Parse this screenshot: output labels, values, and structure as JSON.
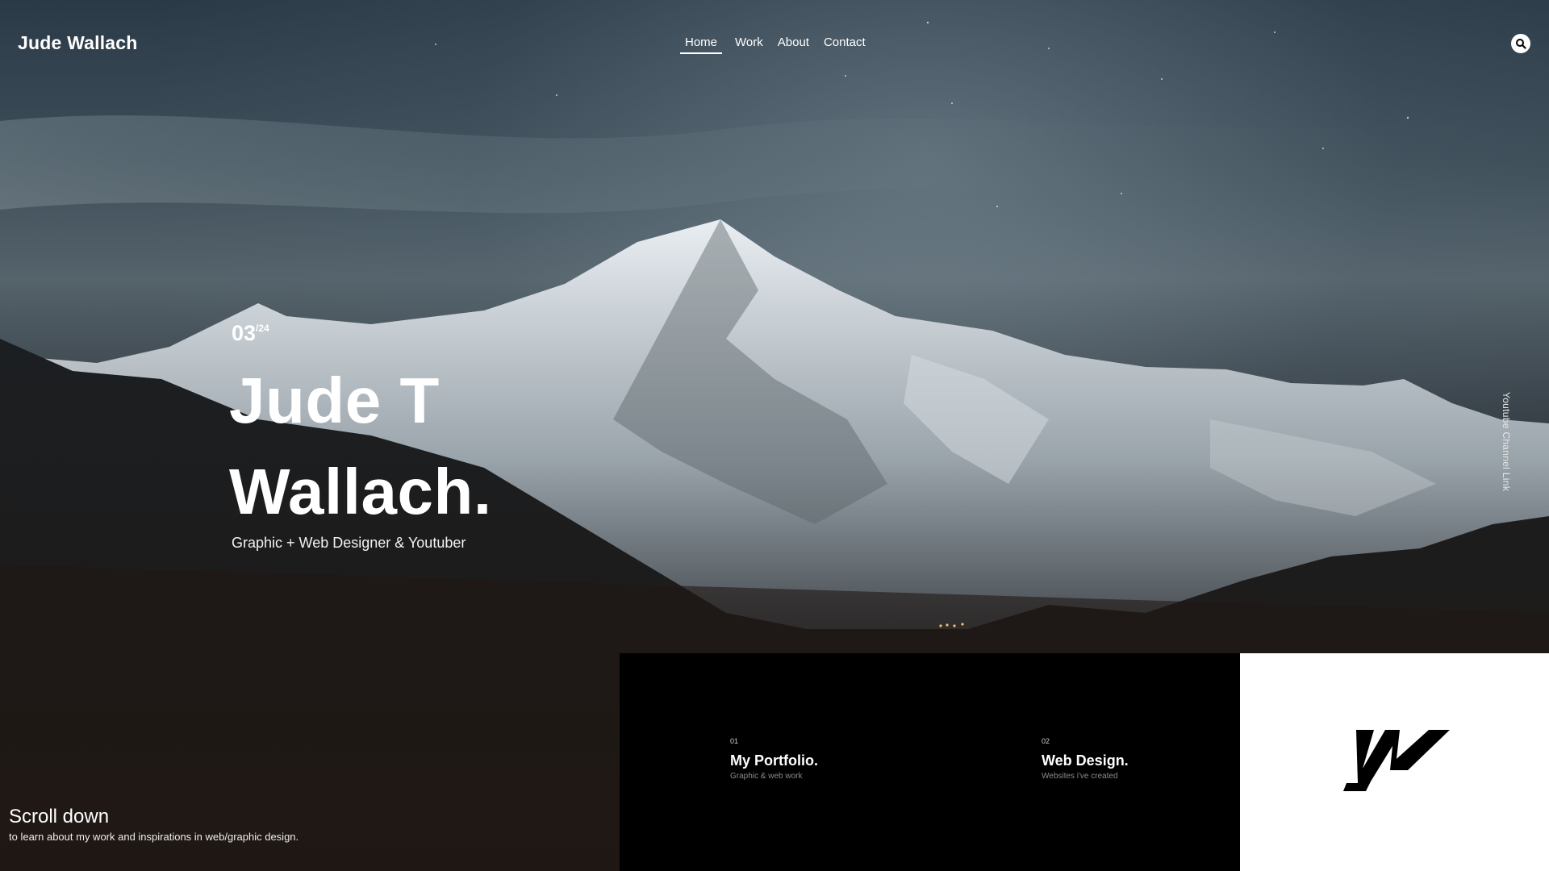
{
  "header": {
    "brand": "Jude Wallach",
    "nav": [
      "Home",
      "Work",
      "About",
      "Contact"
    ],
    "active_nav": "Home",
    "search_icon": "search-icon"
  },
  "hero": {
    "counter_current": "03",
    "counter_total": "/24",
    "title_line1": "Jude T",
    "title_line2": "Wallach.",
    "subtitle": "Graphic + Web Designer & Youtuber"
  },
  "side_link": "Youtube Channel Link",
  "scroll": {
    "title": "Scroll down",
    "subtitle": "to learn about my work and inspirations in web/graphic design."
  },
  "cards": [
    {
      "index": "01",
      "title": "My Portfolio.",
      "subtitle": "Graphic & web work"
    },
    {
      "index": "02",
      "title": "Web Design.",
      "subtitle": "Websites i've created"
    }
  ],
  "logo_icon": "jw-monogram-icon",
  "colors": {
    "text": "#ffffff",
    "panel_dark": "#000000",
    "panel_light": "#ffffff"
  }
}
